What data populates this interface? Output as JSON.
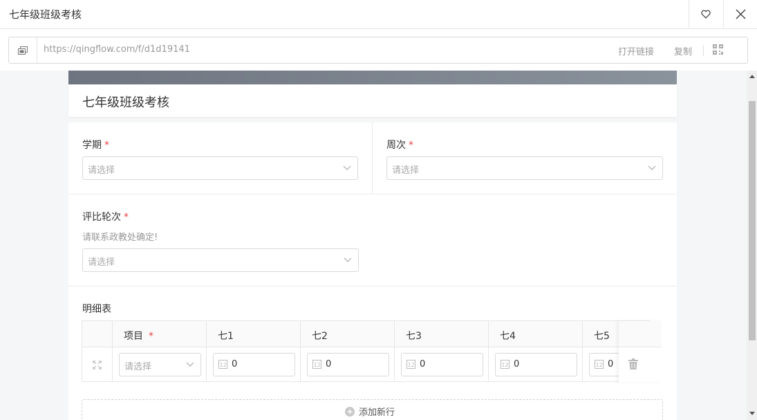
{
  "window": {
    "title": "七年级班级考核"
  },
  "urlbar": {
    "url": "https://qingflow.com/f/d1d19141",
    "open_link": "打开链接",
    "copy": "复制"
  },
  "form": {
    "title": "七年级班级考核",
    "fields": {
      "semester": {
        "label": "学期",
        "placeholder": "请选择"
      },
      "week": {
        "label": "周次",
        "placeholder": "请选择"
      },
      "round": {
        "label": "评比轮次",
        "hint": "请联系政教处确定!",
        "placeholder": "请选择"
      }
    },
    "detail": {
      "label": "明细表",
      "columns": [
        "项目",
        "七1",
        "七2",
        "七3",
        "七4",
        "七5"
      ],
      "row": {
        "item_placeholder": "请选择",
        "values": [
          "0",
          "0",
          "0",
          "0",
          "0"
        ]
      },
      "add_row": "添加新行"
    }
  }
}
